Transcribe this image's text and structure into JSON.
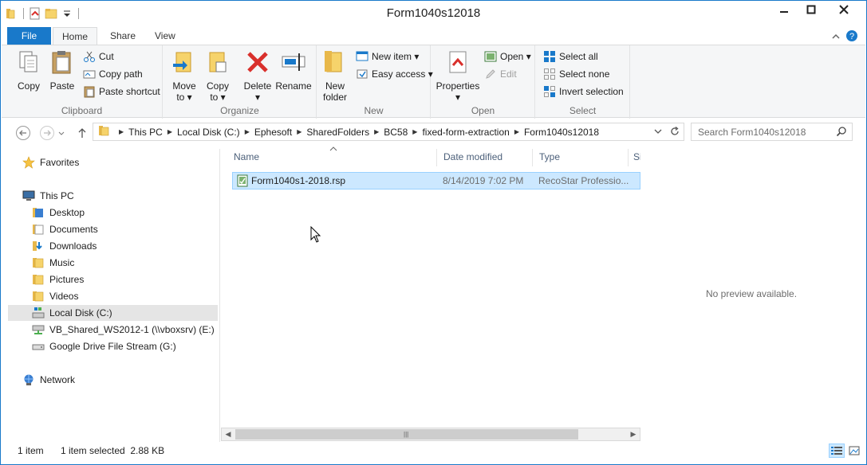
{
  "window": {
    "title": "Form1040s12018"
  },
  "quick_access": {
    "icons": [
      "folder-icon",
      "properties-icon",
      "new-folder-icon",
      "customize-qat-icon"
    ]
  },
  "window_controls": {
    "minimize": "minimize",
    "maximize": "maximize",
    "close": "close"
  },
  "ribbon_tabs": {
    "file": "File",
    "home": "Home",
    "share": "Share",
    "view": "View"
  },
  "ribbon": {
    "clipboard": {
      "label": "Clipboard",
      "copy": "Copy",
      "paste": "Paste",
      "cut": "Cut",
      "copy_path": "Copy path",
      "paste_shortcut": "Paste shortcut"
    },
    "organize": {
      "label": "Organize",
      "move_to_1": "Move",
      "move_to_2": "to ▾",
      "copy_to_1": "Copy",
      "copy_to_2": "to ▾",
      "delete_1": "Delete",
      "delete_2": "▾",
      "rename": "Rename"
    },
    "new": {
      "label": "New",
      "new_folder_1": "New",
      "new_folder_2": "folder",
      "new_item": "New item ▾",
      "easy_access": "Easy access ▾"
    },
    "open": {
      "label": "Open",
      "properties_1": "Properties",
      "properties_2": "▾",
      "open": "Open ▾",
      "edit": "Edit"
    },
    "select": {
      "label": "Select",
      "select_all": "Select all",
      "select_none": "Select none",
      "invert_selection": "Invert selection"
    }
  },
  "address_bar": {
    "breadcrumbs": [
      "This PC",
      "Local Disk (C:)",
      "Ephesoft",
      "SharedFolders",
      "BC58",
      "fixed-form-extraction",
      "Form1040s12018"
    ]
  },
  "search": {
    "placeholder": "Search Form1040s12018"
  },
  "nav_pane": {
    "favorites": "Favorites",
    "this_pc": "This PC",
    "desktop": "Desktop",
    "documents": "Documents",
    "downloads": "Downloads",
    "music": "Music",
    "pictures": "Pictures",
    "videos": "Videos",
    "local_disk": "Local Disk (C:)",
    "vb_shared": "VB_Shared_WS2012-1 (\\\\vboxsrv) (E:)",
    "google_drive": "Google Drive File Stream (G:)",
    "network": "Network"
  },
  "file_list": {
    "columns": {
      "name": "Name",
      "date_modified": "Date modified",
      "type": "Type",
      "size": "Si"
    },
    "rows": [
      {
        "name": "Form1040s1-2018.rsp",
        "date_modified": "8/14/2019 7:02 PM",
        "type": "RecoStar Professio..."
      }
    ]
  },
  "preview": {
    "text": "No preview available."
  },
  "status_bar": {
    "item_count": "1 item",
    "selection": "1 item selected  2.88 KB"
  },
  "colors": {
    "accent": "#1979ca",
    "selection": "#cce8ff",
    "selection_border": "#99d1ff"
  }
}
